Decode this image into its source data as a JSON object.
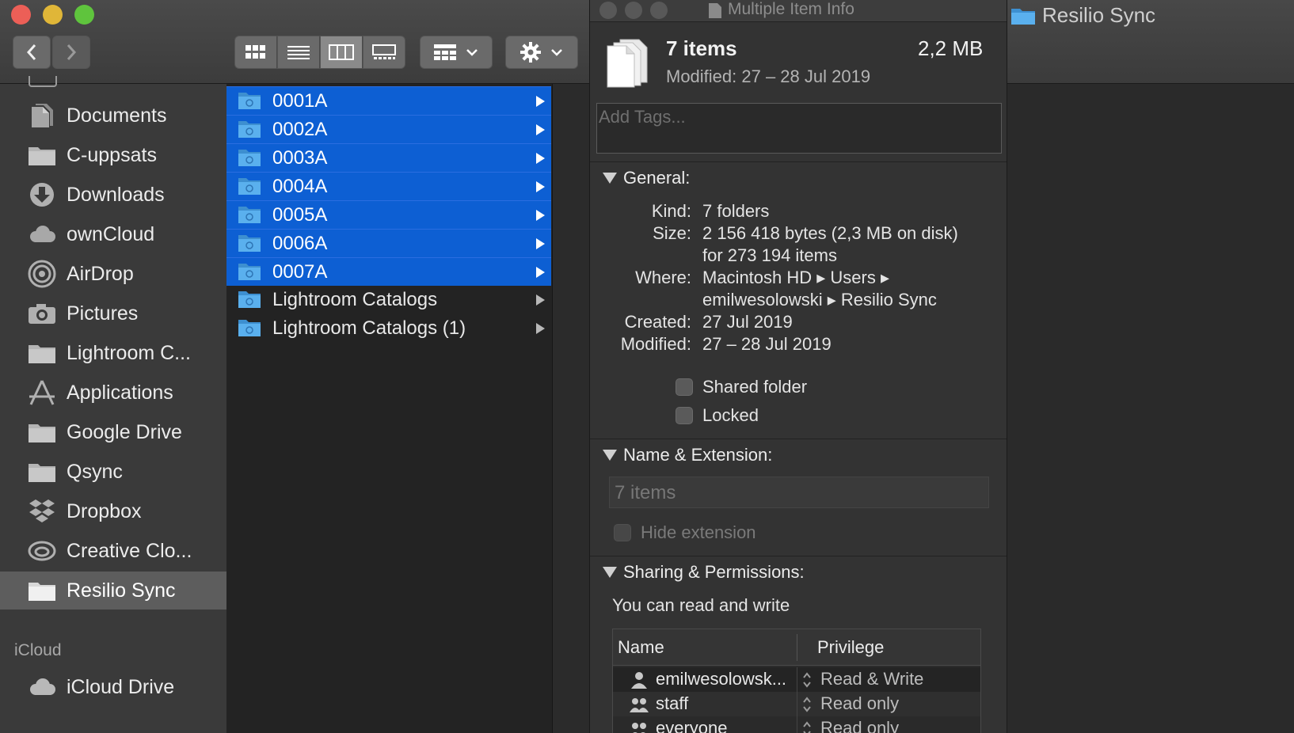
{
  "finder": {
    "toolbar": {
      "back": "back",
      "forward": "forward",
      "views": [
        "icon-view",
        "list-view",
        "column-view",
        "gallery-view"
      ],
      "active_view": "column-view",
      "group_menu": "grid-menu",
      "action_menu": "gear-menu"
    },
    "sidebar": {
      "items": [
        {
          "label": "Documents",
          "icon": "document-icon"
        },
        {
          "label": "C-uppsats",
          "icon": "folder-icon"
        },
        {
          "label": "Downloads",
          "icon": "download-icon"
        },
        {
          "label": "ownCloud",
          "icon": "cloud-icon"
        },
        {
          "label": "AirDrop",
          "icon": "airdrop-icon"
        },
        {
          "label": "Pictures",
          "icon": "camera-icon"
        },
        {
          "label": "Lightroom C...",
          "icon": "folder-icon"
        },
        {
          "label": "Applications",
          "icon": "applications-icon"
        },
        {
          "label": "Google Drive",
          "icon": "folder-icon"
        },
        {
          "label": "Qsync",
          "icon": "folder-icon"
        },
        {
          "label": "Dropbox",
          "icon": "dropbox-icon"
        },
        {
          "label": "Creative Clo...",
          "icon": "creative-cloud-icon"
        },
        {
          "label": "Resilio Sync",
          "icon": "folder-icon",
          "selected": true
        }
      ],
      "icloud_header": "iCloud",
      "icloud_drive": "iCloud Drive"
    },
    "column": {
      "items": [
        {
          "name": "0001A",
          "selected": true
        },
        {
          "name": "0002A",
          "selected": true
        },
        {
          "name": "0003A",
          "selected": true
        },
        {
          "name": "0004A",
          "selected": true
        },
        {
          "name": "0005A",
          "selected": true
        },
        {
          "name": "0006A",
          "selected": true
        },
        {
          "name": "0007A",
          "selected": true
        },
        {
          "name": "Lightroom Catalogs",
          "selected": false
        },
        {
          "name": "Lightroom Catalogs (1)",
          "selected": false
        }
      ]
    },
    "window_title_behind": "Resilio Sync"
  },
  "info": {
    "window_title": "Multiple Item Info",
    "count": "7 items",
    "size": "2,2 MB",
    "modified_header": "Modified: 27 – 28 Jul 2019",
    "tags_placeholder": "Add Tags...",
    "general": {
      "title": "General:",
      "kind_label": "Kind:",
      "kind": "7 folders",
      "size_label": "Size:",
      "size_line1": "2 156 418 bytes (2,3 MB on disk)",
      "size_line2": "for 273 194 items",
      "where_label": "Where:",
      "where_line1": "Macintosh HD ▸ Users ▸",
      "where_line2": "emilwesolowski ▸ Resilio Sync",
      "created_label": "Created:",
      "created": "27 Jul 2019",
      "modified_label": "Modified:",
      "modified": "27 – 28 Jul 2019",
      "shared_folder": "Shared folder",
      "locked": "Locked"
    },
    "name_ext": {
      "title": "Name & Extension:",
      "name_value": "7 items",
      "hide_extension": "Hide extension"
    },
    "sharing": {
      "title": "Sharing & Permissions:",
      "summary": "You can read and write",
      "col_name": "Name",
      "col_privilege": "Privilege",
      "rows": [
        {
          "name": "emilwesolowsk...",
          "privilege": "Read & Write",
          "icon": "user-icon"
        },
        {
          "name": "staff",
          "privilege": "Read only",
          "icon": "group-icon"
        },
        {
          "name": "everyone",
          "privilege": "Read only",
          "icon": "group-icon"
        }
      ]
    }
  },
  "colors": {
    "selection": "#0d5fd3",
    "folder_blue": "#4ea6e6",
    "close": "#ec5f57",
    "minimize": "#e0b638",
    "zoom": "#5fc43d"
  }
}
